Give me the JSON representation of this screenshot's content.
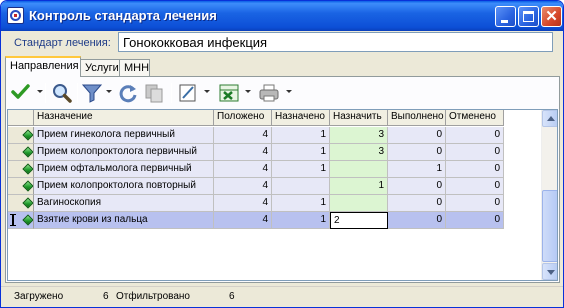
{
  "window": {
    "title": "Контроль стандарта лечения"
  },
  "standard": {
    "label": "Стандарт лечения:",
    "value": "Гонококковая инфекция"
  },
  "tabs": [
    {
      "label": "Направления",
      "active": true
    },
    {
      "label": "Услуги",
      "active": false
    },
    {
      "label": "МНН",
      "active": false
    }
  ],
  "toolbar": {
    "icons": [
      "checkmark-icon",
      "magnifier-icon",
      "filter-icon",
      "refresh-icon",
      "copy-icon",
      "edit-icon",
      "excel-icon",
      "printer-icon"
    ]
  },
  "grid": {
    "columns": [
      "Назначение",
      "Положено",
      "Назначено",
      "Назначить",
      "Выполнено",
      "Отменено"
    ],
    "rows": [
      {
        "name": "Прием гинеколога первичный",
        "polozheno": "4",
        "naznacheno": "1",
        "naznachit": "3",
        "vypolneno": "0",
        "otmeneno": "0"
      },
      {
        "name": "Прием колопроктолога первичный",
        "polozheno": "4",
        "naznacheno": "1",
        "naznachit": "3",
        "vypolneno": "0",
        "otmeneno": "0"
      },
      {
        "name": "Прием офтальмолога первичный",
        "polozheno": "4",
        "naznacheno": "1",
        "naznachit": "",
        "vypolneno": "1",
        "otmeneno": "0"
      },
      {
        "name": "Прием колопроктолога повторный",
        "polozheno": "4",
        "naznacheno": "",
        "naznachit": "1",
        "vypolneno": "0",
        "otmeneno": "0"
      },
      {
        "name": "Вагиноскопия",
        "polozheno": "4",
        "naznacheno": "1",
        "naznachit": "",
        "vypolneno": "0",
        "otmeneno": "0"
      },
      {
        "name": "Взятие крови из пальца",
        "polozheno": "4",
        "naznacheno": "1",
        "naznachit": "2",
        "vypolneno": "0",
        "otmeneno": "0"
      }
    ]
  },
  "status": {
    "loaded_label": "Загружено",
    "loaded_value": "6",
    "filtered_label": "Отфильтровано",
    "filtered_value": "6"
  }
}
